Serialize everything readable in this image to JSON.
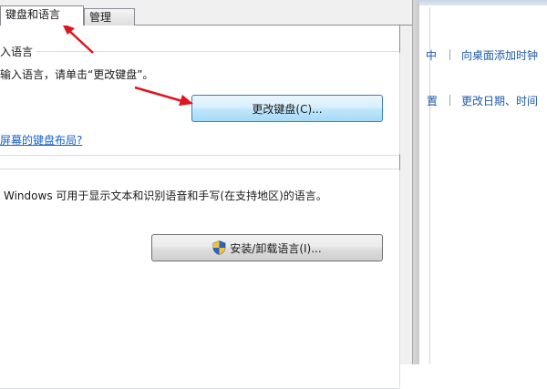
{
  "tabs": {
    "keyboard_languages": "键盘和语言",
    "administrative": "管理"
  },
  "input_group": {
    "title": "入语言",
    "description": "输入语言，请单击“更改键盘”。",
    "change_keyboard_button": "更改键盘(C)...",
    "layout_link": "屏幕的键盘布局?"
  },
  "display_language": {
    "description": "Windows 可用于显示文本和识别语音和手写(在支持地区)的语言。",
    "install_button": "安装/卸载语言(I)..."
  },
  "control_panel": {
    "row1_fragment": "中",
    "row1_link": "向桌面添加时钟",
    "row2_fragment": "置",
    "row2_link": "更改日期、时间"
  },
  "colors": {
    "arrow": "#e0141e",
    "link": "#1a62c7",
    "button_focus_border": "#3c7fb1"
  },
  "icons": {
    "install_button": "uac-shield-icon",
    "annotation": "red-arrow-icon"
  }
}
